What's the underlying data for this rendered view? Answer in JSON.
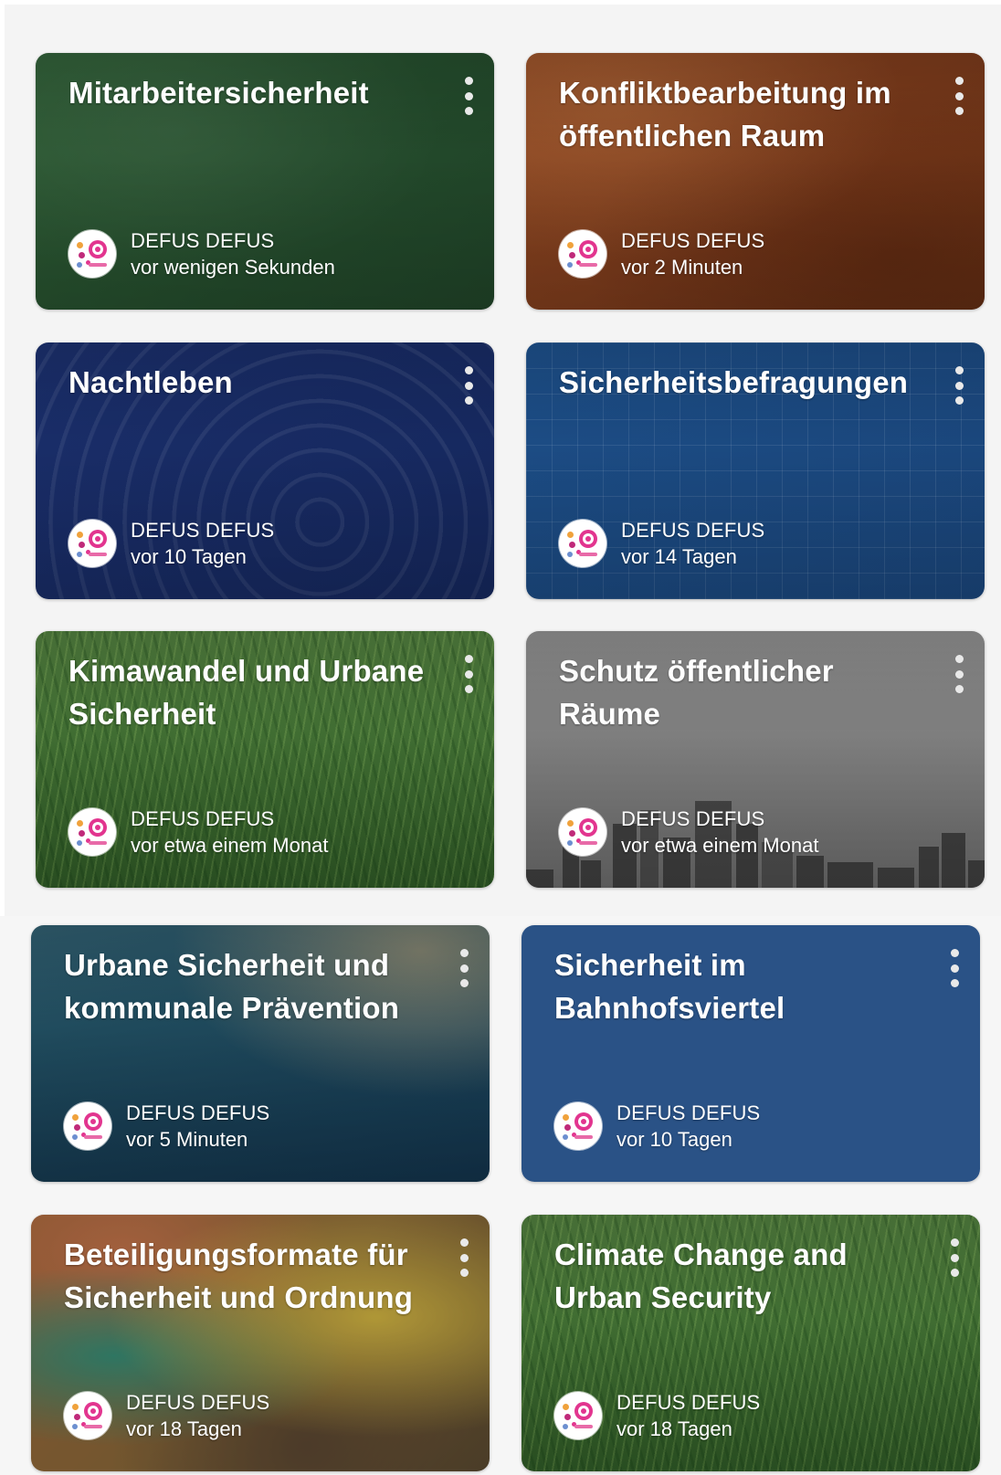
{
  "cards": [
    {
      "title": "Mitarbeitersicherheit",
      "author": "DEFUS DEFUS",
      "time": "vor wenigen Sekunden",
      "background": "green-chalkboard"
    },
    {
      "title": "Konfliktbearbeitung im öffentlichen Raum",
      "author": "DEFUS DEFUS",
      "time": "vor 2 Minuten",
      "background": "brown-leather"
    },
    {
      "title": "Nachtleben",
      "author": "DEFUS DEFUS",
      "time": "vor 10 Tagen",
      "background": "navy-circles"
    },
    {
      "title": "Sicherheitsbefragungen",
      "author": "DEFUS DEFUS",
      "time": "vor 14 Tagen",
      "background": "blue-grid"
    },
    {
      "title": "Kimawandel und Urbane Sicherheit",
      "author": "DEFUS DEFUS",
      "time": "vor etwa einem Monat",
      "background": "grass"
    },
    {
      "title": "Schutz öffentlicher Räume",
      "author": "DEFUS DEFUS",
      "time": "vor etwa einem Monat",
      "background": "grey-city-skyline"
    },
    {
      "title": "Urbane Sicherheit und kommunale Prävention",
      "author": "DEFUS DEFUS",
      "time": "vor 5 Minuten",
      "background": "ocean-wave"
    },
    {
      "title": "Sicherheit im Bahnhofsviertel",
      "author": "DEFUS DEFUS",
      "time": "vor 10 Tagen",
      "background": "flat-blue"
    },
    {
      "title": "Beteiligungsformate für Sicherheit und Ordnung",
      "author": "DEFUS DEFUS",
      "time": "vor 18 Tagen",
      "background": "painted-wall"
    },
    {
      "title": "Climate Change and Urban Security",
      "author": "DEFUS DEFUS",
      "time": "vor 18 Tagen",
      "background": "grass"
    }
  ],
  "colors": {
    "page_background": "#f4f4f4",
    "menu_dots": "#e9e9e9",
    "text": "#ffffff",
    "avatar_accent": "#e2358f"
  },
  "icons": {
    "menu": "more-vert-icon",
    "avatar": "defus-logo-avatar"
  }
}
